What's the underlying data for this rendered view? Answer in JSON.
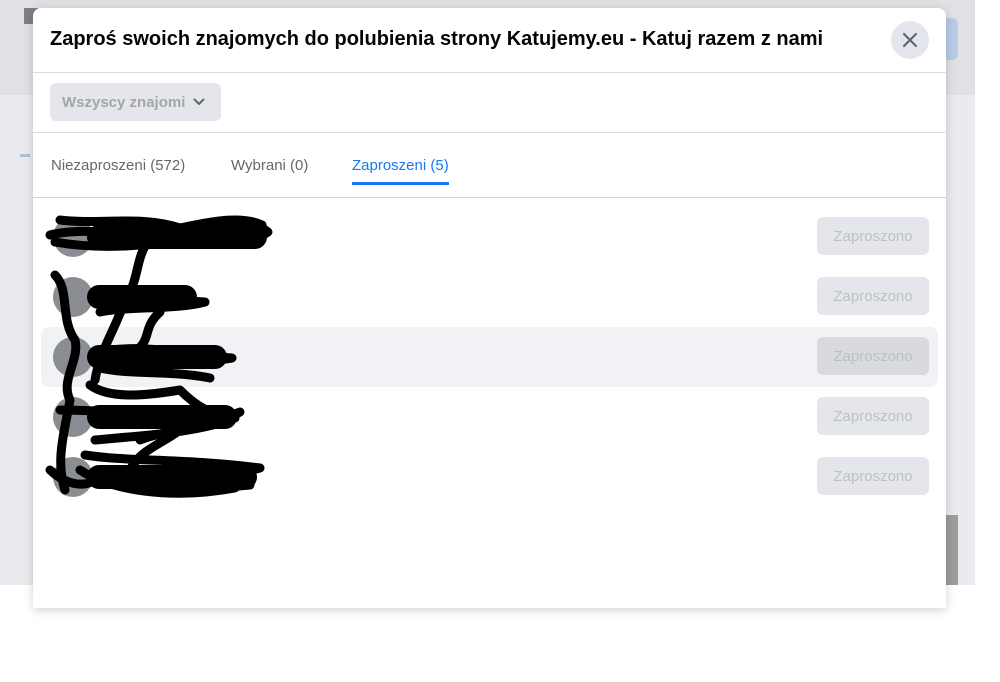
{
  "dialog": {
    "title": "Zaproś swoich znajomych do polubienia strony Katujemy.eu - Katuj razem z nami",
    "close_icon": "close-icon"
  },
  "filter": {
    "label": "Wszyscy znajomi",
    "icon": "chevron-down-icon"
  },
  "tabs": [
    {
      "label": "Niezaproszeni (572)",
      "active": false
    },
    {
      "label": "Wybrani (0)",
      "active": false
    },
    {
      "label": "Zaproszeni (5)",
      "active": true
    }
  ],
  "friends": [
    {
      "status": "Zaproszono"
    },
    {
      "status": "Zaproszono"
    },
    {
      "status": "Zaproszono"
    },
    {
      "status": "Zaproszono"
    },
    {
      "status": "Zaproszono"
    }
  ],
  "colors": {
    "accent": "#1877f2",
    "button_bg": "#e4e6eb",
    "disabled_text": "#bcc0c4",
    "redaction": "#000000"
  }
}
